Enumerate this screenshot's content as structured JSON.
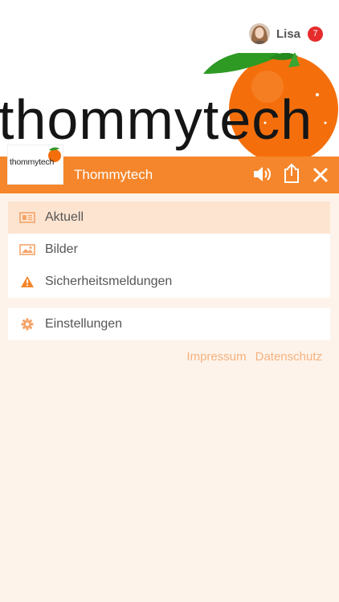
{
  "user": {
    "name": "Lisa",
    "notifications": "7"
  },
  "banner": {
    "brand_text": "thommytech"
  },
  "header": {
    "logo_text": "thommytech",
    "title": "Thommytech"
  },
  "menu": {
    "items": [
      {
        "label": "Aktuell",
        "icon": "newspaper-icon",
        "active": true
      },
      {
        "label": "Bilder",
        "icon": "image-icon",
        "active": false
      },
      {
        "label": "Sicherheitsmeldungen",
        "icon": "warning-icon",
        "active": false
      }
    ],
    "settings": {
      "label": "Einstellungen",
      "icon": "gear-icon"
    }
  },
  "footer": {
    "impressum": "Impressum",
    "datenschutz": "Datenschutz"
  },
  "colors": {
    "accent": "#f5862b",
    "active_bg": "#fde4d0",
    "page_bg": "#fdf3ea",
    "badge": "#e62b2b",
    "link": "#f6b27f"
  }
}
